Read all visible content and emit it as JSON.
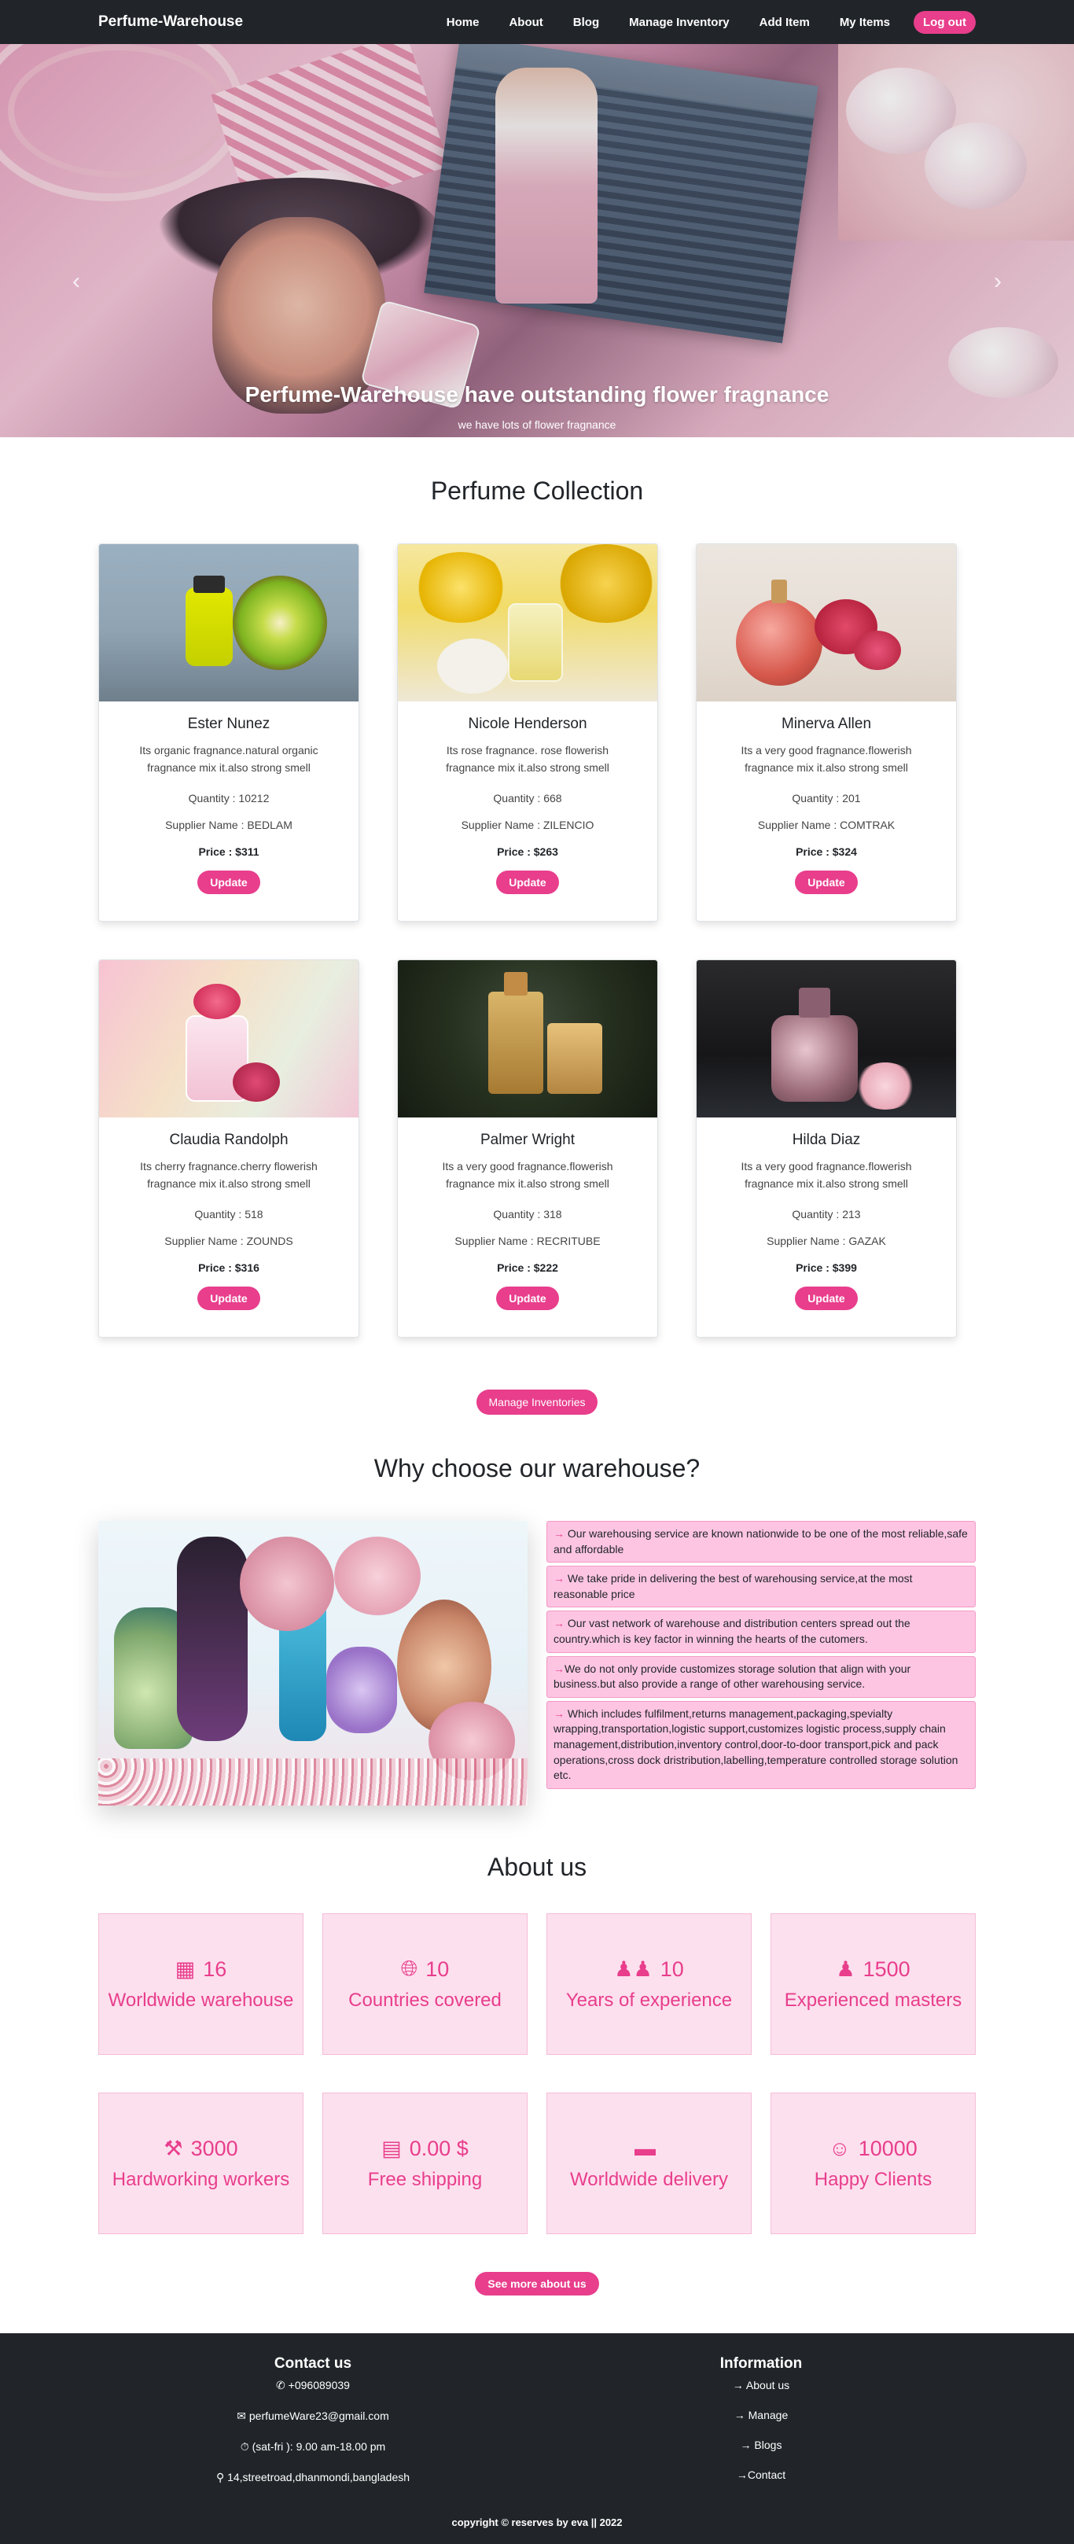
{
  "nav": {
    "brand": "Perfume-Warehouse",
    "links": [
      "Home",
      "About",
      "Blog",
      "Manage Inventory",
      "Add Item",
      "My Items"
    ],
    "logout": "Log out"
  },
  "hero": {
    "title": "Perfume-Warehouse have outstanding flower fragnance",
    "subtitle": "we have lots of flower fragnance",
    "prev_icon": "chevron-left-icon",
    "next_icon": "chevron-right-icon"
  },
  "collection": {
    "title": "Perfume Collection",
    "items": [
      {
        "name": "Ester Nunez",
        "desc": "Its organic fragnance.natural organic fragnance mix it.also strong smell",
        "qty": "Quantity : 10212",
        "supplier": "Supplier Name : BEDLAM",
        "price": "Price : $311",
        "button": "Update"
      },
      {
        "name": "Nicole Henderson",
        "desc": "Its rose fragnance. rose flowerish fragnance mix it.also strong smell",
        "qty": "Quantity : 668",
        "supplier": "Supplier Name : ZILENCIO",
        "price": "Price : $263",
        "button": "Update"
      },
      {
        "name": "Minerva Allen",
        "desc": "Its a very good fragnance.flowerish fragnance mix it.also strong smell",
        "qty": "Quantity : 201",
        "supplier": "Supplier Name : COMTRAK",
        "price": "Price : $324",
        "button": "Update"
      },
      {
        "name": "Claudia Randolph",
        "desc": "Its cherry fragnance.cherry flowerish fragnance mix it.also strong smell",
        "qty": "Quantity : 518",
        "supplier": "Supplier Name : ZOUNDS",
        "price": "Price : $316",
        "button": "Update"
      },
      {
        "name": "Palmer Wright",
        "desc": "Its a very good fragnance.flowerish fragnance mix it.also strong smell",
        "qty": "Quantity : 318",
        "supplier": "Supplier Name : RECRITUBE",
        "price": "Price : $222",
        "button": "Update"
      },
      {
        "name": "Hilda Diaz",
        "desc": "Its a very good fragnance.flowerish fragnance mix it.also strong smell",
        "qty": "Quantity : 213",
        "supplier": "Supplier Name : GAZAK",
        "price": "Price : $399",
        "button": "Update"
      }
    ],
    "manage_button": "Manage Inventories"
  },
  "why": {
    "title": "Why choose our warehouse?",
    "items": [
      " Our warehousing service are known nationwide to be one of the most reliable,safe and affordable",
      " We take pride in delivering the best of warehousing service,at the most reasonable price",
      " Our vast network of warehouse and distribution centers spread out the country.which is key factor in winning the hearts of the cutomers.",
      "We do not only provide customizes storage solution that align with your business.but also provide a range of other warehousing service.",
      " Which includes fulfilment,returns management,packaging,spevialty wrapping,transportation,logistic support,customizes logistic process,supply chain management,distribution,inventory control,door-to-door transport,pick and pack operations,cross dock dristribution,labelling,temperature controlled storage solution etc."
    ]
  },
  "about": {
    "title": "About us",
    "stats": [
      {
        "icon": "building-icon",
        "num": "16",
        "label": "Worldwide warehouse"
      },
      {
        "icon": "globe-icon",
        "num": "10",
        "label": "Countries covered"
      },
      {
        "icon": "users-icon",
        "num": "10",
        "label": "Years of experience"
      },
      {
        "icon": "user-icon",
        "num": "1500",
        "label": "Experienced masters"
      },
      {
        "icon": "worker-icon",
        "num": "3000",
        "label": "Hardworking workers"
      },
      {
        "icon": "invoice-dollar-icon",
        "num": "0.00 $",
        "label": "Free shipping"
      },
      {
        "icon": "truck-loading-icon",
        "num": "",
        "label": "Worldwide delivery"
      },
      {
        "icon": "happy-people-icon",
        "num": "10000",
        "label": "Happy Clients"
      }
    ],
    "see_more": "See more about us"
  },
  "footer": {
    "contact_title": "Contact us",
    "phone": "+096089039",
    "email": "perfumeWare23@gmail.com",
    "hours": "(sat-fri ): 9.00 am-18.00 pm",
    "address": "14,streetroad,dhanmondi,bangladesh",
    "info_title": "Information",
    "info_links": [
      "About us",
      "Manage",
      "Blogs",
      "Contact"
    ],
    "copyright": "copyright © reserves by eva || 2022"
  },
  "colors": {
    "accent": "#e83e8c",
    "dark": "#212529",
    "pink_light": "#fde0ee"
  }
}
